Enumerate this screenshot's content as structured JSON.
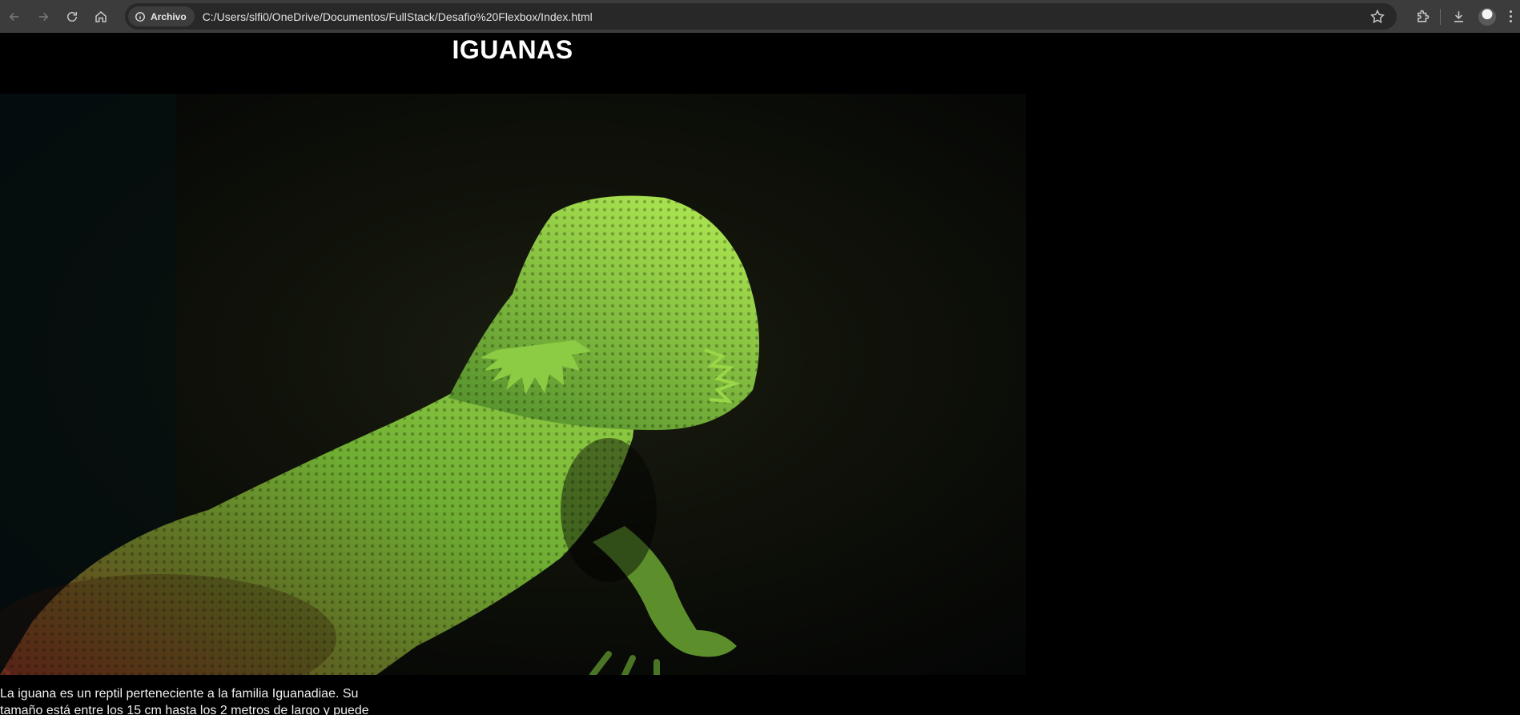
{
  "browser": {
    "security_chip": "Archivo",
    "url": "C:/Users/slfi0/OneDrive/Documentos/FullStack/Desafio%20Flexbox/Index.html",
    "icons": [
      "back-icon",
      "forward-icon",
      "reload-icon",
      "home-icon",
      "info-icon",
      "star-icon",
      "extensions-icon",
      "download-icon",
      "avatar",
      "menu-icon"
    ]
  },
  "page": {
    "title": "IGUANAS",
    "description": "La iguana es un reptil perteneciente a la familia Iguanadiae. Su tamaño está entre los 15 cm hasta los 2 metros de largo y puede"
  },
  "colors": {
    "page_background": "#000000",
    "browser_toolbar": "#3c3c3c",
    "omnibox": "#282828",
    "lizard_green": "#7fc43a"
  }
}
